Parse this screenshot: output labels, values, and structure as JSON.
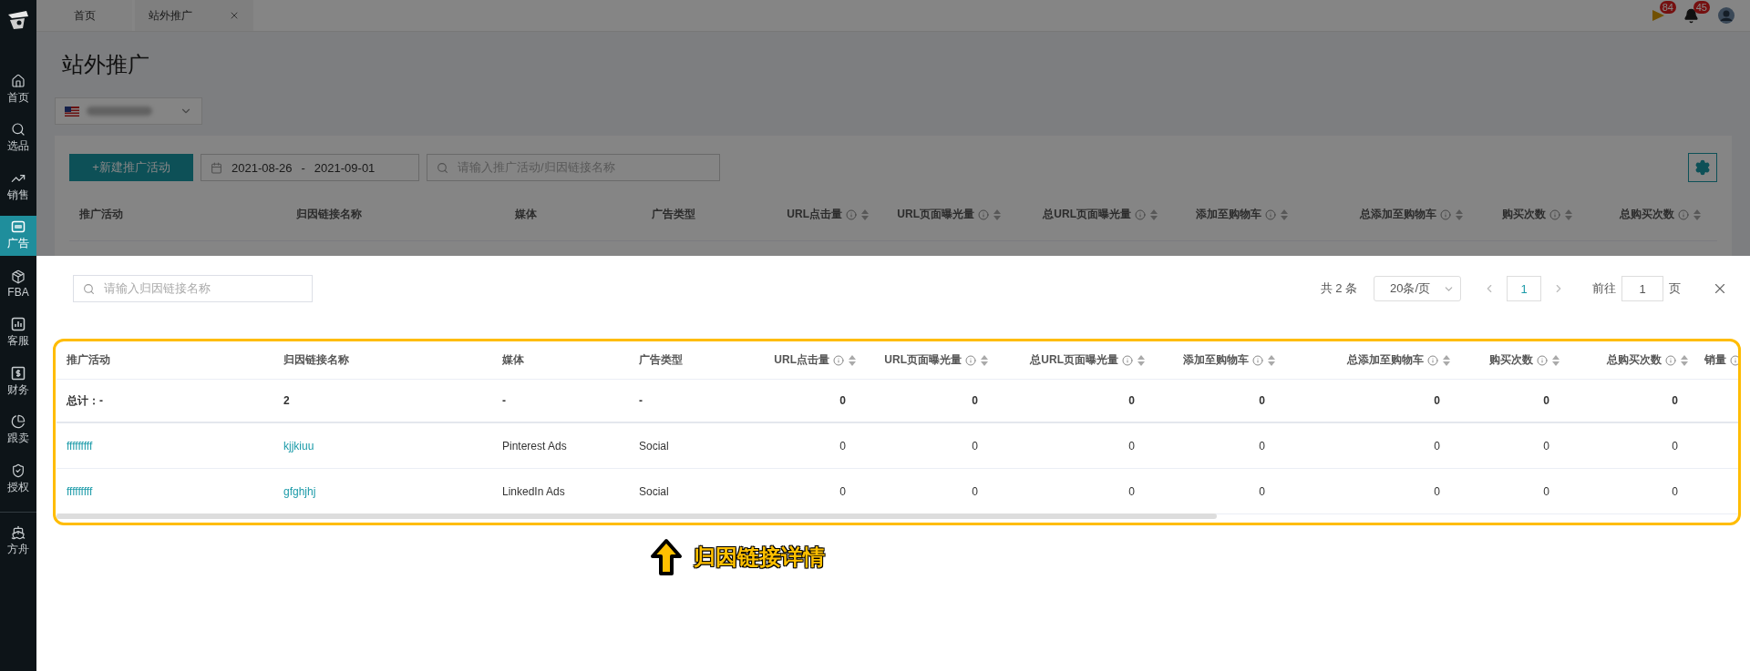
{
  "sidebar": {
    "items": [
      {
        "label": "首页",
        "selected": false
      },
      {
        "label": "选品",
        "selected": false
      },
      {
        "label": "销售",
        "selected": false
      },
      {
        "label": "广告",
        "selected": true
      },
      {
        "label": "FBA",
        "selected": false
      },
      {
        "label": "客服",
        "selected": false
      },
      {
        "label": "财务",
        "selected": false
      },
      {
        "label": "跟卖",
        "selected": false
      },
      {
        "label": "授权",
        "selected": false
      },
      {
        "label": "方舟",
        "selected": false
      }
    ]
  },
  "tabs": [
    {
      "label": "首页",
      "selected": false,
      "closable": false
    },
    {
      "label": "站外推广",
      "selected": true,
      "closable": true
    }
  ],
  "header_icons": [
    {
      "kind": "flag",
      "badge": "84"
    },
    {
      "kind": "bell",
      "badge": "45"
    },
    {
      "kind": "avatar"
    }
  ],
  "page": {
    "title": "站外推广",
    "toolbar": {
      "new_button": "+新建推广活动",
      "date_start": "2021-08-26",
      "date_sep": "-",
      "date_end": "2021-09-01",
      "search_placeholder": "请输入推广活动/归因链接名称"
    },
    "columns": [
      {
        "label": "推广活动",
        "kind": "text"
      },
      {
        "label": "归因链接名称",
        "kind": "text"
      },
      {
        "label": "媒体",
        "kind": "text"
      },
      {
        "label": "广告类型",
        "kind": "text"
      },
      {
        "label": "URL点击量",
        "kind": "metric"
      },
      {
        "label": "URL页面曝光量",
        "kind": "metric"
      },
      {
        "label": "总URL页面曝光量",
        "kind": "metric"
      },
      {
        "label": "添加至购物车",
        "kind": "metric"
      },
      {
        "label": "总添加至购物车",
        "kind": "metric"
      },
      {
        "label": "购买次数",
        "kind": "metric"
      },
      {
        "label": "总购买次数",
        "kind": "metric"
      }
    ]
  },
  "drawer": {
    "search_placeholder": "请输入归因链接名称",
    "pagination": {
      "total": "共 2 条",
      "page_size": "20条/页",
      "pages": [
        {
          "label": "1",
          "selected": true
        }
      ],
      "goto_label": "前往",
      "goto_value": "1",
      "page_suffix": "页"
    },
    "table": {
      "columns": [
        {
          "label": "推广活动",
          "kind": "link"
        },
        {
          "label": "归因链接名称",
          "kind": "link"
        },
        {
          "label": "媒体",
          "kind": "text"
        },
        {
          "label": "广告类型",
          "kind": "text"
        },
        {
          "label": "URL点击量",
          "kind": "metric"
        },
        {
          "label": "URL页面曝光量",
          "kind": "metric"
        },
        {
          "label": "总URL页面曝光量",
          "kind": "metric"
        },
        {
          "label": "添加至购物车",
          "kind": "metric"
        },
        {
          "label": "总添加至购物车",
          "kind": "metric"
        },
        {
          "label": "购买次数",
          "kind": "metric"
        },
        {
          "label": "总购买次数",
          "kind": "metric"
        },
        {
          "label": "销量",
          "kind": "metric"
        }
      ],
      "rows": [
        {
          "kind": "total",
          "cells": [
            "总计：-",
            "2",
            "-",
            "-",
            "0",
            "0",
            "0",
            "0",
            "0",
            "0",
            "0"
          ]
        },
        {
          "kind": "data",
          "cells": [
            "fffffffff",
            "kjjkiuu",
            "Pinterest Ads",
            "Social",
            "0",
            "0",
            "0",
            "0",
            "0",
            "0",
            "0"
          ]
        },
        {
          "kind": "data",
          "cells": [
            "fffffffff",
            "gfghjhj",
            "LinkedIn Ads",
            "Social",
            "0",
            "0",
            "0",
            "0",
            "0",
            "0",
            "0"
          ]
        }
      ]
    }
  },
  "annotation": {
    "text": "归因链接详情"
  }
}
